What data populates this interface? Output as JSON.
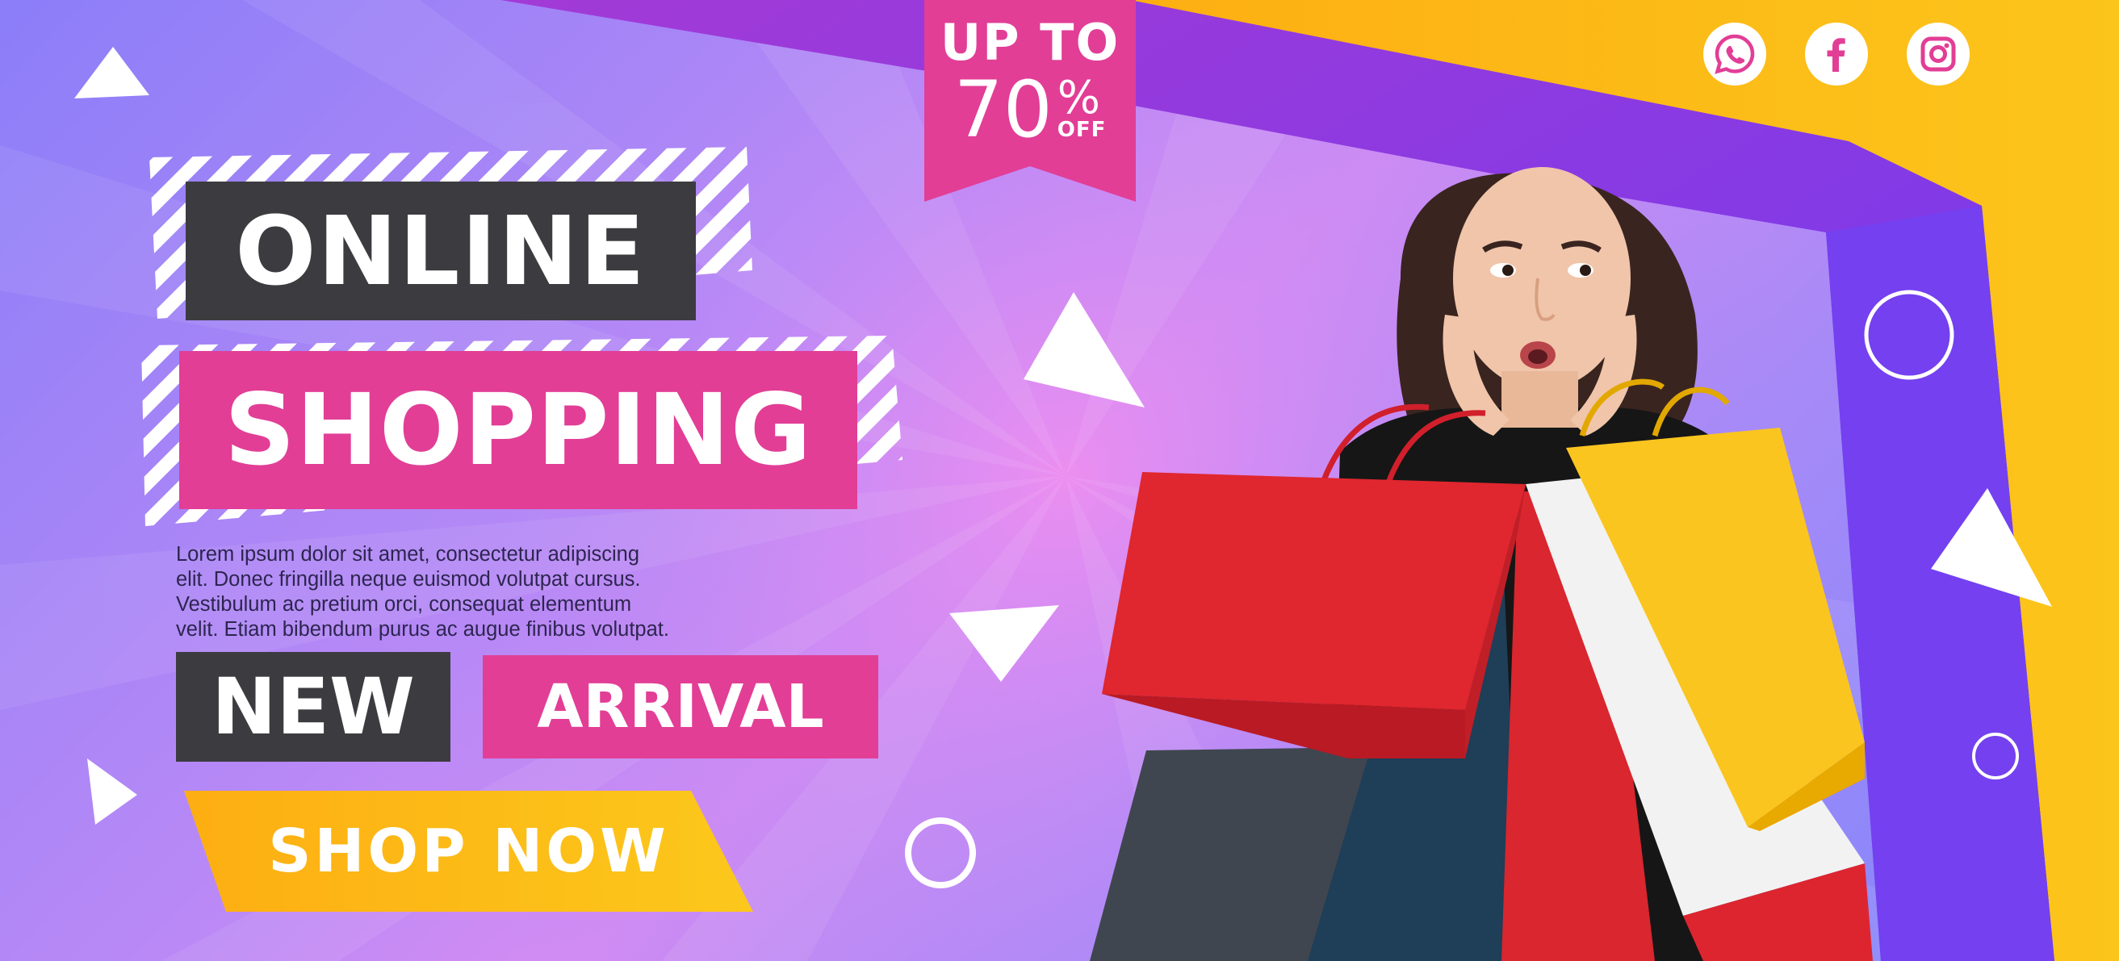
{
  "banner": {
    "headline_line1": "ONLINE",
    "headline_line2": "SHOPPING",
    "description_lines": [
      "Lorem ipsum dolor sit amet, consectetur adipiscing",
      "elit. Donec fringilla neque euismod volutpat cursus.",
      "Vestibulum ac pretium orci, consequat elementum",
      "velit. Etiam bibendum purus ac augue finibus volutpat."
    ],
    "tag_new": "NEW",
    "tag_arrival": "ARRIVAL",
    "cta_label": "SHOP NOW"
  },
  "discount": {
    "prefix": "UP TO",
    "amount": "70",
    "percent_sign": "%",
    "suffix": "OFF"
  },
  "social": [
    {
      "name": "whatsapp",
      "icon": "whatsapp-icon"
    },
    {
      "name": "facebook",
      "icon": "facebook-icon"
    },
    {
      "name": "instagram",
      "icon": "instagram-icon"
    }
  ],
  "colors": {
    "pink": "#e23e96",
    "dark": "#3c3c40",
    "orange": "#fdb60f",
    "purple": "#7d3ff0",
    "white": "#ffffff"
  }
}
